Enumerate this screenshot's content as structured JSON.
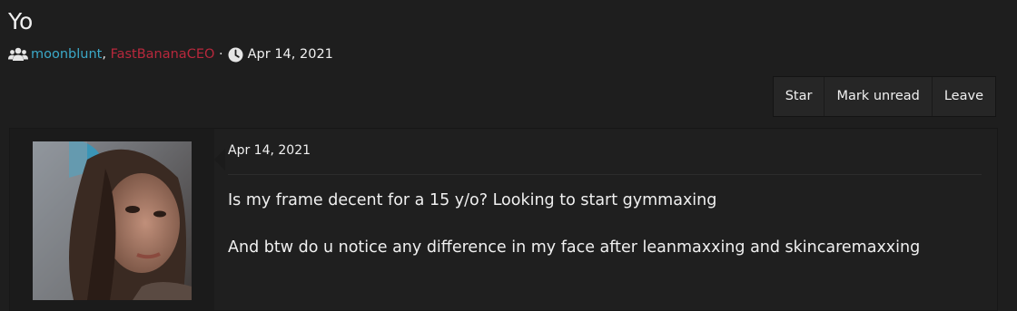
{
  "thread": {
    "title": "Yo",
    "participants": [
      "moonblunt",
      "FastBananaCEO"
    ],
    "participant_separator": ",",
    "dot": "·",
    "date": "Apr 14, 2021"
  },
  "actions": {
    "star": "Star",
    "mark_unread": "Mark unread",
    "leave": "Leave"
  },
  "message": {
    "date": "Apr 14, 2021",
    "paragraphs": [
      "Is my frame decent for a 15 y/o? Looking to start gymmaxing",
      "And btw do u notice any difference in my face after leanmaxxing and skincaremaxxing"
    ]
  },
  "colors": {
    "background": "#1e1e1e",
    "participant_1": "#3ba9c8",
    "participant_2": "#b8283c"
  },
  "icons": {
    "participants": "users-icon",
    "date": "clock-icon"
  }
}
